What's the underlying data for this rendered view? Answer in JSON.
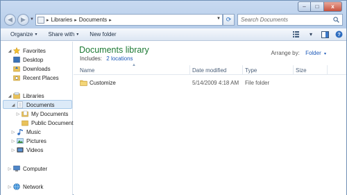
{
  "window_controls": {
    "minimize": "–",
    "maximize": "□",
    "close": "x"
  },
  "address_bar": {
    "segments": [
      "Libraries",
      "Documents"
    ],
    "separator": "▸"
  },
  "search": {
    "placeholder": "Search Documents"
  },
  "command_bar": {
    "organize": "Organize",
    "share_with": "Share with",
    "new_folder": "New folder",
    "caret": "▾"
  },
  "nav_pane": {
    "favorites": {
      "label": "Favorites",
      "items": [
        "Desktop",
        "Downloads",
        "Recent Places"
      ]
    },
    "libraries": {
      "label": "Libraries",
      "documents": {
        "label": "Documents",
        "children": [
          "My Documents",
          "Public Documents"
        ]
      },
      "others": [
        "Music",
        "Pictures",
        "Videos"
      ]
    },
    "computer": "Computer",
    "network": "Network"
  },
  "content": {
    "title": "Documents library",
    "includes_label": "Includes:",
    "includes_link": "2 locations",
    "arrange_label": "Arrange by:",
    "arrange_value": "Folder",
    "columns": [
      "Name",
      "Date modified",
      "Type",
      "Size"
    ],
    "rows": [
      {
        "name": "Customize",
        "date_modified": "5/14/2009 4:18 AM",
        "type": "File folder",
        "size": ""
      }
    ]
  },
  "colors": {
    "title_green": "#1e7a34",
    "link_blue": "#1b58b8",
    "selection_bg": "#dceaf8"
  }
}
